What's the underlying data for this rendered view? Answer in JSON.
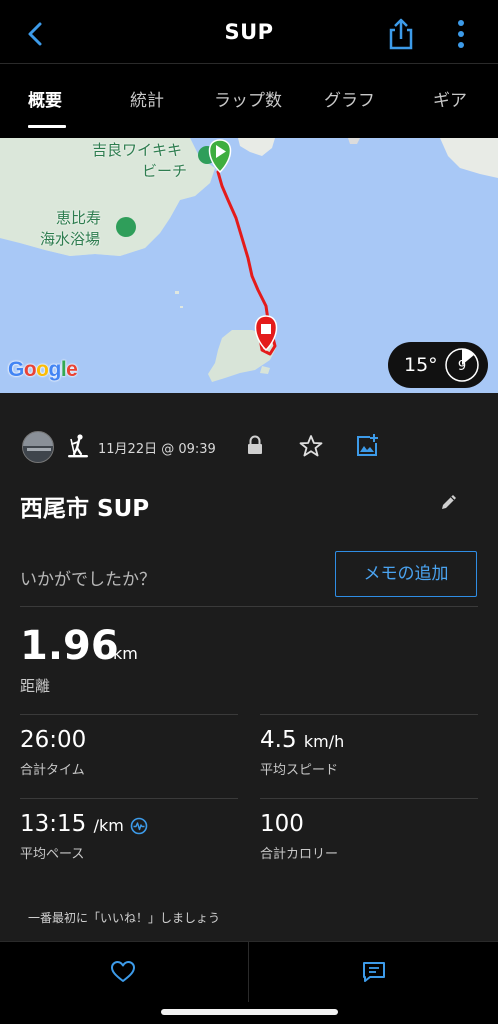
{
  "header": {
    "title": "SUP"
  },
  "tabs": [
    {
      "label": "概要",
      "active": true
    },
    {
      "label": "統計"
    },
    {
      "label": "ラップ数"
    },
    {
      "label": "グラフ"
    },
    {
      "label": "ギア"
    }
  ],
  "map": {
    "labels": {
      "beach1_line1": "吉良ワイキキ",
      "beach1_line2": "ビーチ",
      "beach2_line1": "恵比寿",
      "beach2_line2": "海水浴場"
    },
    "google": {
      "G": "G",
      "o1": "o",
      "o2": "o",
      "g": "g",
      "l": "l",
      "e": "e"
    },
    "wind": {
      "temperature": "15°",
      "speed": "9"
    }
  },
  "activity": {
    "date": "11月22日 @ 09:39",
    "title": "西尾市 SUP",
    "feeling_prompt": "いかがでしたか？",
    "memo_button": "メモの追加"
  },
  "stats": {
    "distance": {
      "value": "1.96",
      "unit": "km",
      "label": "距離"
    },
    "total_time": {
      "value": "26:00",
      "label": "合計タイム"
    },
    "avg_speed": {
      "value": "4.5",
      "unit": "km/h",
      "label": "平均スピード"
    },
    "avg_pace": {
      "value": "13:15",
      "unit": "/km",
      "label": "平均ペース"
    },
    "calories": {
      "value": "100",
      "label": "合計カロリー"
    }
  },
  "like_prompt": "一番最初に「いいね！」しましょう",
  "colors": {
    "accent": "#2f8de4",
    "route": "#e41b1b",
    "start_marker": "#3fae3f",
    "water": "#a8c8f6",
    "land": "#e8ebe6"
  },
  "icons": [
    "back-icon",
    "share-icon",
    "more-icon",
    "sup-icon",
    "lock-icon",
    "star-icon",
    "add-photo-icon",
    "edit-icon",
    "pace-zone-icon",
    "heart-icon",
    "comment-icon"
  ]
}
